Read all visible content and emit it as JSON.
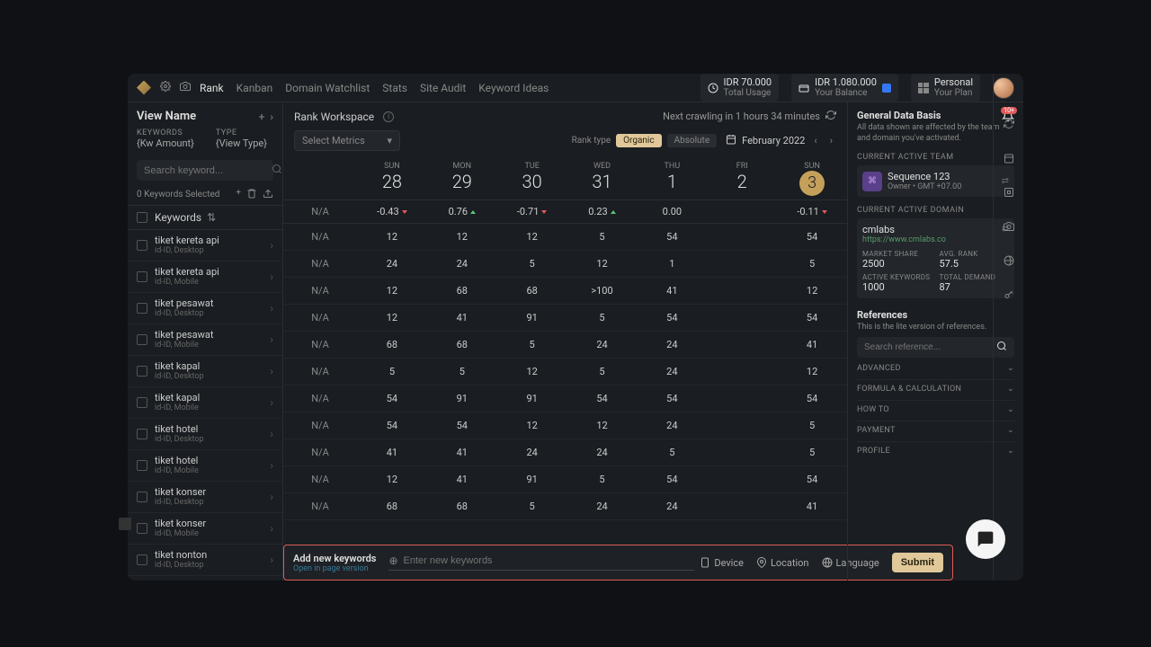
{
  "topbar": {
    "nav": [
      "Rank",
      "Kanban",
      "Domain Watchlist",
      "Stats",
      "Site Audit",
      "Keyword Ideas"
    ],
    "usage": {
      "amount": "IDR 70.000",
      "label": "Total Usage"
    },
    "balance": {
      "amount": "IDR 1.080.000",
      "label": "Your Balance"
    },
    "plan": {
      "name": "Personal",
      "label": "Your Plan"
    }
  },
  "sidebar": {
    "view_name": "View Name",
    "keywords_lbl": "KEYWORDS",
    "type_lbl": "TYPE",
    "kw_amount": "{Kw Amount}",
    "view_type": "{View Type}",
    "search_placeholder": "Search keyword...",
    "selected": "0 Keywords Selected",
    "header": "Keywords",
    "rows": [
      {
        "name": "tiket kereta api",
        "sub": "id-ID, Desktop"
      },
      {
        "name": "tiket kereta api",
        "sub": "id-ID, Mobile"
      },
      {
        "name": "tiket pesawat",
        "sub": "id-ID, Desktop"
      },
      {
        "name": "tiket pesawat",
        "sub": "id-ID, Mobile"
      },
      {
        "name": "tiket kapal",
        "sub": "id-ID, Desktop"
      },
      {
        "name": "tiket kapal",
        "sub": "id-ID, Mobile"
      },
      {
        "name": "tiket hotel",
        "sub": "id-ID, Desktop"
      },
      {
        "name": "tiket hotel",
        "sub": "id-ID, Mobile"
      },
      {
        "name": "tiket konser",
        "sub": "id-ID, Desktop"
      },
      {
        "name": "tiket konser",
        "sub": "id-ID, Mobile"
      },
      {
        "name": "tiket nonton",
        "sub": "id-ID, Desktop"
      }
    ]
  },
  "main": {
    "workspace": "Rank Workspace",
    "crawl": "Next crawling in 1 hours 34 minutes",
    "select_metrics": "Select Metrics",
    "rank_type_lbl": "Rank type",
    "organic": "Organic",
    "absolute": "Absolute",
    "month": "February 2022",
    "days": [
      {
        "d": "SUN",
        "n": "28"
      },
      {
        "d": "MON",
        "n": "29"
      },
      {
        "d": "TUE",
        "n": "30"
      },
      {
        "d": "WED",
        "n": "31"
      },
      {
        "d": "THU",
        "n": "1"
      },
      {
        "d": "FRI",
        "n": "2"
      },
      {
        "d": "SUN",
        "n": "3",
        "hl": true
      }
    ],
    "na": "N/A",
    "deltas": [
      {
        "v": "-0.43",
        "dir": "down"
      },
      {
        "v": "0.76",
        "dir": "up"
      },
      {
        "v": "-0.71",
        "dir": "down"
      },
      {
        "v": "0.23",
        "dir": "up"
      },
      {
        "v": "0.00",
        "dir": ""
      },
      {
        "v": "",
        "dir": ""
      },
      {
        "v": "-0.11",
        "dir": "down"
      }
    ],
    "data": [
      [
        "N/A",
        "12",
        "12",
        "12",
        "5",
        "54",
        "",
        "54"
      ],
      [
        "N/A",
        "24",
        "24",
        "5",
        "12",
        "1",
        "",
        "5"
      ],
      [
        "N/A",
        "12",
        "68",
        "68",
        ">100",
        "41",
        "",
        "12"
      ],
      [
        "N/A",
        "12",
        "41",
        "91",
        "5",
        "54",
        "",
        "54"
      ],
      [
        "N/A",
        "68",
        "68",
        "5",
        "24",
        "24",
        "",
        "41"
      ],
      [
        "N/A",
        "5",
        "5",
        "12",
        "5",
        "24",
        "",
        "12"
      ],
      [
        "N/A",
        "54",
        "91",
        "91",
        "54",
        "54",
        "",
        "54"
      ],
      [
        "N/A",
        "54",
        "54",
        "12",
        "12",
        "24",
        "",
        "5"
      ],
      [
        "N/A",
        "41",
        "41",
        "24",
        "24",
        "5",
        "",
        "5"
      ],
      [
        "N/A",
        "12",
        "41",
        "91",
        "5",
        "54",
        "",
        "54"
      ],
      [
        "N/A",
        "68",
        "68",
        "5",
        "24",
        "24",
        "",
        "41"
      ]
    ]
  },
  "right": {
    "title": "General Data Basis",
    "sub": "All data shown are affected by the team and domain you've activated.",
    "bell_badge": "10+",
    "team_lbl": "CURRENT ACTIVE TEAM",
    "team_name": "Sequence 123",
    "team_role": "Owner • GMT +07.00",
    "domain_lbl": "CURRENT ACTIVE DOMAIN",
    "domain_name": "cmlabs",
    "domain_url": "https://www.cmlabs.co",
    "stats": [
      {
        "l": "MARKET SHARE",
        "v": "2500"
      },
      {
        "l": "AVG. RANK",
        "v": "57.5"
      },
      {
        "l": "ACTIVE KEYWORDS",
        "v": "1000"
      },
      {
        "l": "TOTAL DEMAND",
        "v": "87"
      }
    ],
    "ref_title": "References",
    "ref_sub": "This is the lite version of references.",
    "ref_search_placeholder": "Search reference...",
    "accordion": [
      "ADVANCED",
      "FORMULA & CALCULATION",
      "HOW TO",
      "PAYMENT",
      "PROFILE"
    ]
  },
  "footer": {
    "title": "Add new keywords",
    "link": "Open in page version",
    "placeholder": "Enter new keywords",
    "device": "Device",
    "location": "Location",
    "language": "Language",
    "submit": "Submit"
  }
}
